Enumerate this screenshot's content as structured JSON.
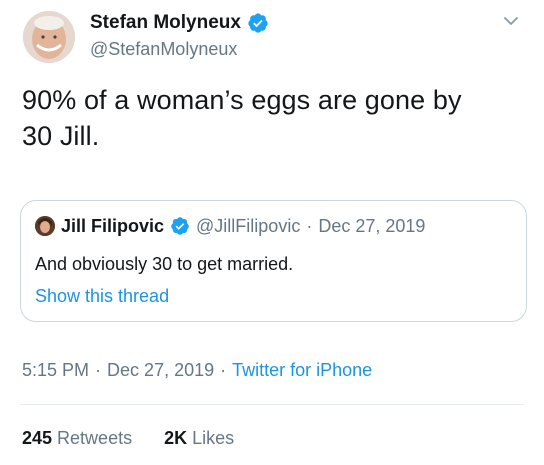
{
  "author": {
    "display_name": "Stefan Molyneux",
    "handle": "@StefanMolyneux",
    "verified_icon": "verified-badge-icon",
    "menu_icon": "chevron-down-icon"
  },
  "tweet": {
    "text": "90% of a woman’s eggs are gone by\n30 Jill."
  },
  "quote": {
    "display_name": "Jill Filipovic",
    "handle": "@JillFilipovic",
    "separator": "·",
    "date": "Dec 27, 2019",
    "text": "And obviously 30 to get married.",
    "show_thread": "Show this thread"
  },
  "meta": {
    "time": "5:15 PM",
    "sep1": "·",
    "date": "Dec 27, 2019",
    "sep2": "·",
    "source": "Twitter for iPhone"
  },
  "stats": {
    "retweets_count": "245",
    "retweets_label": "Retweets",
    "likes_count": "2K",
    "likes_label": "Likes"
  },
  "colors": {
    "accent_blue": "#1b95e0",
    "secondary_text": "#657786",
    "border": "#ccd6dd"
  }
}
